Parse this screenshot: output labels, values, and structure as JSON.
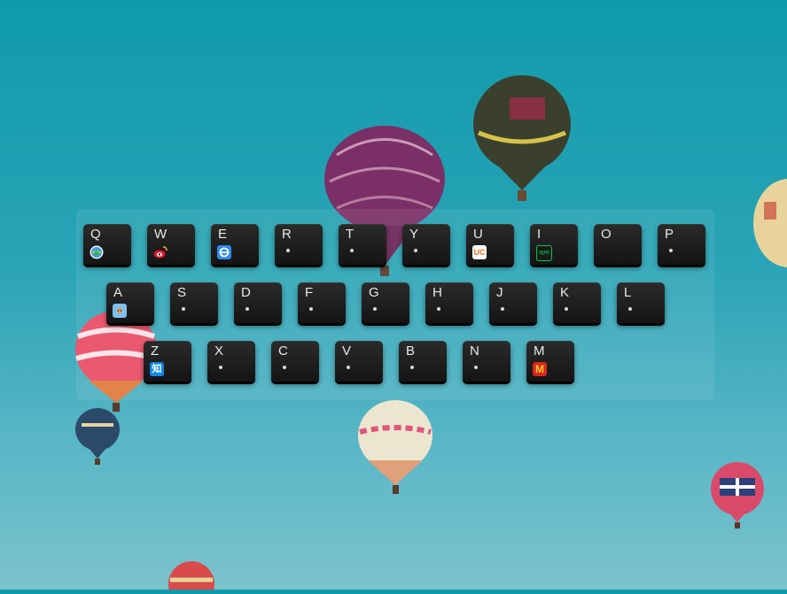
{
  "keyboard": {
    "rows": [
      [
        {
          "letter": "Q",
          "icon": "browser-360-icon"
        },
        {
          "letter": "W",
          "icon": "weibo-icon"
        },
        {
          "letter": "E",
          "icon": "ie-browser-icon"
        },
        {
          "letter": "R",
          "icon": "dot"
        },
        {
          "letter": "T",
          "icon": "dot"
        },
        {
          "letter": "Y",
          "icon": "dot"
        },
        {
          "letter": "U",
          "icon": "uc-browser-icon",
          "icon_text": "UC"
        },
        {
          "letter": "I",
          "icon": "iqiyi-icon",
          "icon_text": "iQIYI"
        },
        {
          "letter": "O",
          "icon": "none"
        },
        {
          "letter": "P",
          "icon": "dot"
        }
      ],
      [
        {
          "letter": "A",
          "icon": "fox-avatar-icon"
        },
        {
          "letter": "S",
          "icon": "dot"
        },
        {
          "letter": "D",
          "icon": "dot"
        },
        {
          "letter": "F",
          "icon": "dot"
        },
        {
          "letter": "G",
          "icon": "dot"
        },
        {
          "letter": "H",
          "icon": "dot"
        },
        {
          "letter": "J",
          "icon": "dot"
        },
        {
          "letter": "K",
          "icon": "dot"
        },
        {
          "letter": "L",
          "icon": "dot"
        }
      ],
      [
        {
          "letter": "Z",
          "icon": "zhihu-icon",
          "icon_text": "知"
        },
        {
          "letter": "X",
          "icon": "dot"
        },
        {
          "letter": "C",
          "icon": "dot"
        },
        {
          "letter": "V",
          "icon": "dot"
        },
        {
          "letter": "B",
          "icon": "dot"
        },
        {
          "letter": "N",
          "icon": "dot"
        },
        {
          "letter": "M",
          "icon": "mcdonalds-icon",
          "icon_text": "M"
        }
      ]
    ]
  },
  "colors": {
    "sky_top": "#0f9aab",
    "sky_bottom": "#7cc3cd",
    "key_face": "#1b1b1b",
    "key_text": "#e8e8e8"
  }
}
